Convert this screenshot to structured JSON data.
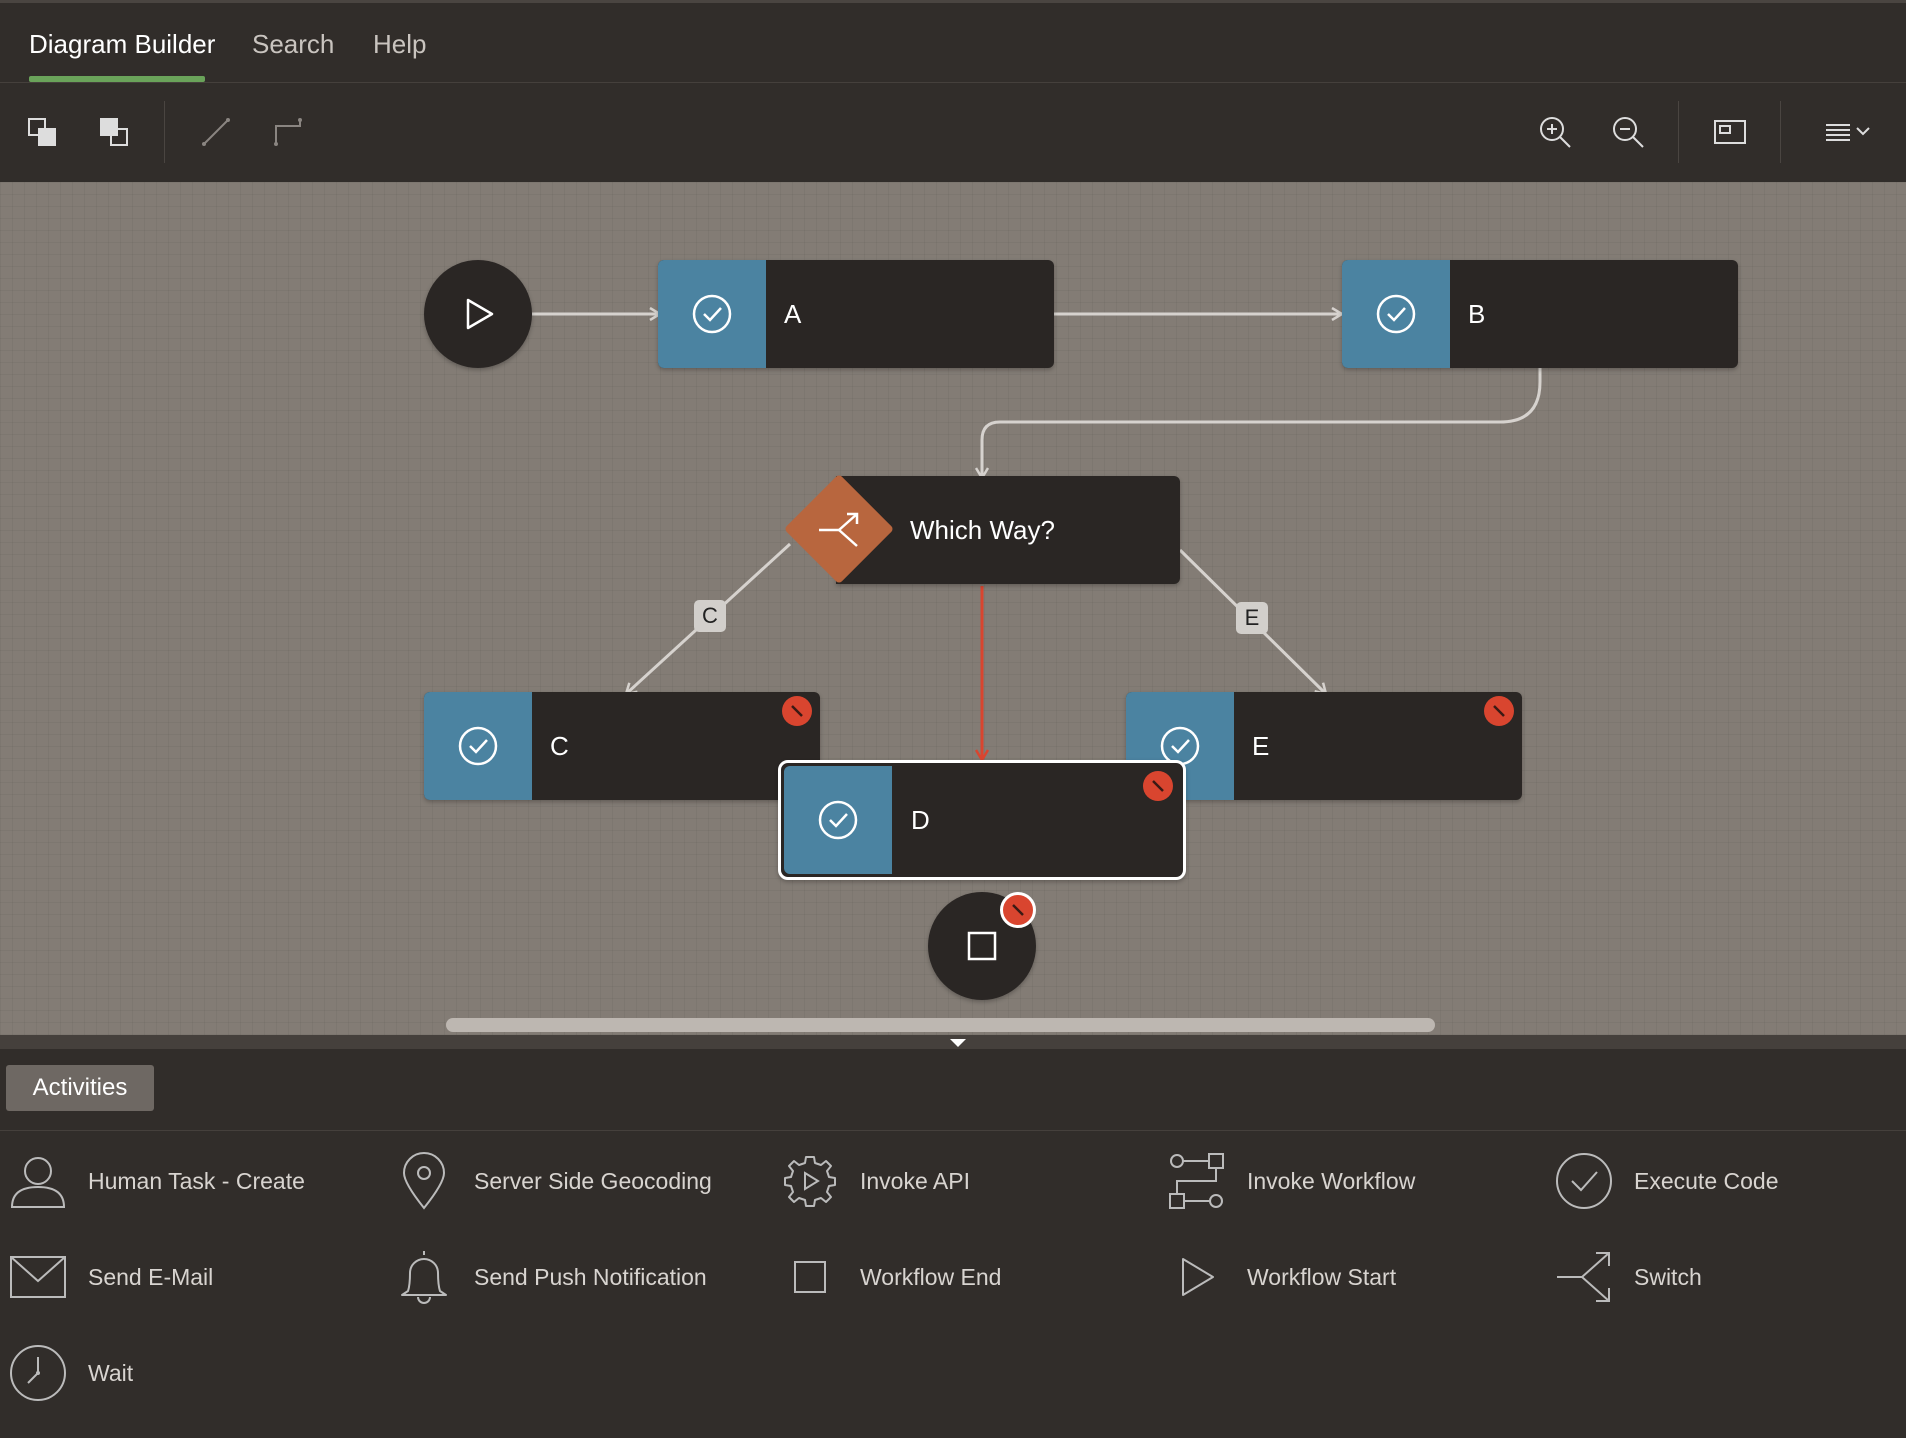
{
  "tabs": [
    {
      "label": "Diagram Builder",
      "active": true
    },
    {
      "label": "Search",
      "active": false
    },
    {
      "label": "Help",
      "active": false
    }
  ],
  "toolbar": {
    "left_icons": [
      "bring-to-front-icon",
      "send-to-back-icon",
      "straight-connector-icon",
      "elbow-connector-icon"
    ],
    "right_icons": [
      "zoom-in-icon",
      "zoom-out-icon",
      "fit-to-screen-icon",
      "menu-icon"
    ]
  },
  "diagram": {
    "nodes": [
      {
        "id": "A",
        "label": "A",
        "type": "activity",
        "error": false
      },
      {
        "id": "B",
        "label": "B",
        "type": "activity",
        "error": false
      },
      {
        "id": "switch",
        "label": "Which Way?",
        "type": "switch",
        "error": false
      },
      {
        "id": "C",
        "label": "C",
        "type": "activity",
        "error": true
      },
      {
        "id": "E",
        "label": "E",
        "type": "activity",
        "error": true
      },
      {
        "id": "D",
        "label": "D",
        "type": "activity",
        "error": true,
        "selected": true
      },
      {
        "id": "start",
        "label": "",
        "type": "start",
        "error": false
      },
      {
        "id": "end",
        "label": "",
        "type": "end",
        "error": true
      }
    ],
    "edge_labels": {
      "c": "C",
      "e": "E"
    },
    "colors": {
      "activity": "#4b83a1",
      "switch": "#b8663e",
      "error": "#d9452f",
      "highlight_edge": "#d9452f"
    }
  },
  "palette": {
    "tab_label": "Activities",
    "items": [
      {
        "label": "Human Task - Create",
        "icon": "person-icon"
      },
      {
        "label": "Server Side Geocoding",
        "icon": "map-pin-icon"
      },
      {
        "label": "Invoke API",
        "icon": "gear-play-icon"
      },
      {
        "label": "Invoke Workflow",
        "icon": "workflow-icon"
      },
      {
        "label": "Execute Code",
        "icon": "check-circle-icon"
      },
      {
        "label": "Send E-Mail",
        "icon": "envelope-icon"
      },
      {
        "label": "Send Push Notification",
        "icon": "bell-icon"
      },
      {
        "label": "Workflow End",
        "icon": "square-icon"
      },
      {
        "label": "Workflow Start",
        "icon": "play-icon"
      },
      {
        "label": "Switch",
        "icon": "switch-icon"
      },
      {
        "label": "Wait",
        "icon": "clock-icon"
      }
    ]
  }
}
